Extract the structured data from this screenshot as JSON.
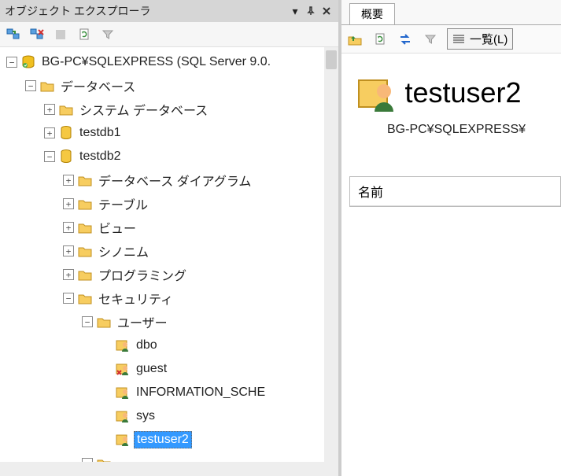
{
  "panel": {
    "title": "オブジェクト エクスプローラ"
  },
  "tree": {
    "server": "BG-PC¥SQLEXPRESS (SQL Server 9.0.",
    "databases": "データベース",
    "sysdb": "システム データベース",
    "testdb1": "testdb1",
    "testdb2": "testdb2",
    "diagrams": "データベース ダイアグラム",
    "tables": "テーブル",
    "views": "ビュー",
    "synonyms": "シノニム",
    "programming": "プログラミング",
    "security": "セキュリティ",
    "users": "ユーザー",
    "u_dbo": "dbo",
    "u_guest": "guest",
    "u_info": "INFORMATION_SCHE",
    "u_sys": "sys",
    "u_testuser2": "testuser2"
  },
  "right": {
    "tab": "概要",
    "viewmode": "一覧(L)",
    "title": "testuser2",
    "path": "BG-PC¥SQLEXPRESS¥",
    "col_name": "名前"
  }
}
